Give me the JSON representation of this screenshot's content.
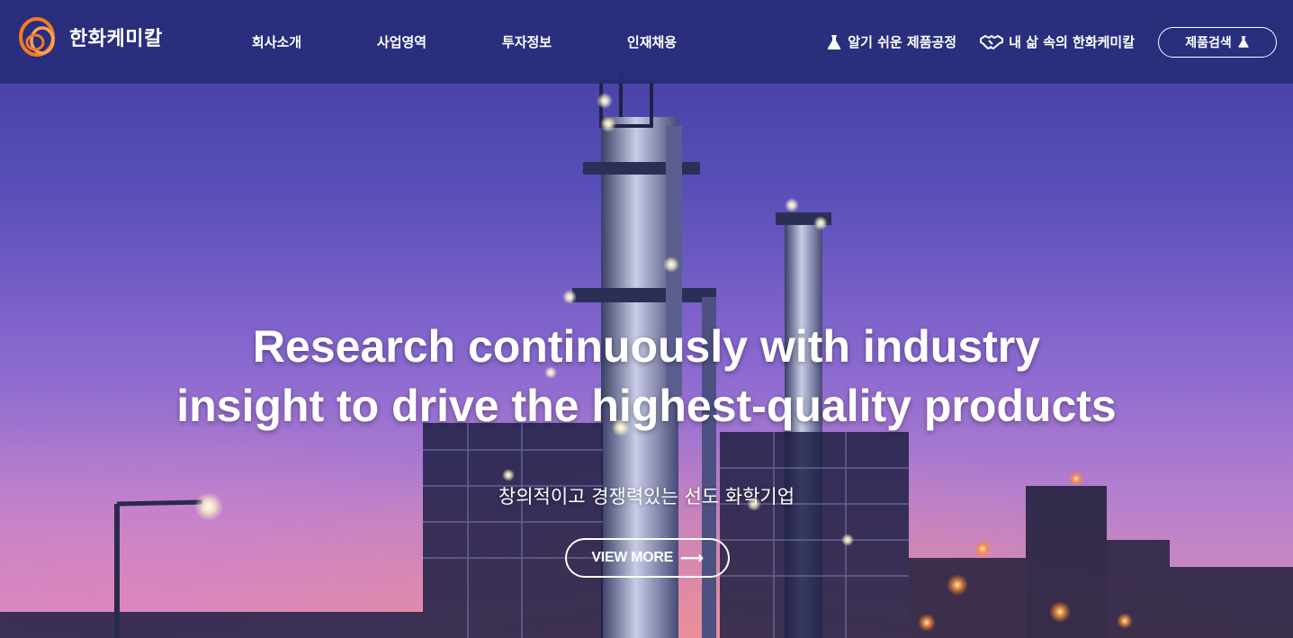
{
  "brand": {
    "name": "한화케미칼"
  },
  "nav": {
    "items": [
      {
        "label": "회사소개"
      },
      {
        "label": "사업영역"
      },
      {
        "label": "투자정보"
      },
      {
        "label": "인재채용"
      }
    ]
  },
  "utility": {
    "process_link": "알기 쉬운 제품공정",
    "life_link": "내 삶 속의 한화케미칼",
    "search_button": "제품검색"
  },
  "hero": {
    "headline_line1": "Research continuously with industry",
    "headline_line2": "insight to drive the highest-quality products",
    "subheading": "창의적이고 경쟁력있는 선도 화학기업",
    "cta_label": "VIEW MORE",
    "cta_arrow": "⟶"
  },
  "colors": {
    "header_bg": "#262c78",
    "logo_orange": "#f47a20",
    "text": "#ffffff"
  }
}
